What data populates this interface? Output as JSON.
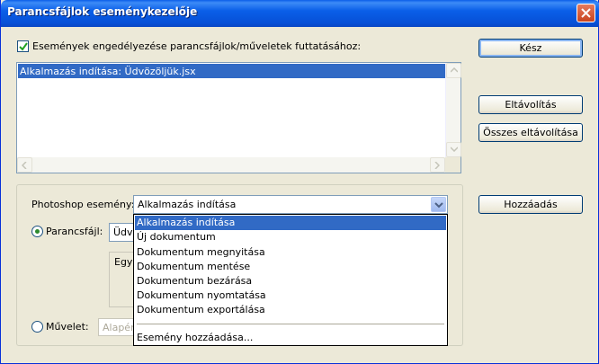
{
  "window": {
    "title": "Parancsfájlok eseménykezelője"
  },
  "enable_checkbox": {
    "checked": true,
    "label": "Események engedélyezése parancsfájlok/műveletek futtatásához:"
  },
  "events_list": {
    "items": [
      "Alkalmazás indítása: Üdvözöljük.jsx"
    ],
    "selected_index": 0
  },
  "group": {
    "event_label": "Photoshop esemény:",
    "event_value": "Alkalmazás indítása",
    "dropdown": {
      "options": [
        "Alkalmazás indítása",
        "Új dokumentum",
        "Dokumentum megnyitása",
        "Dokumentum mentése",
        "Dokumentum bezárása",
        "Dokumentum nyomtatása",
        "Dokumentum exportálása"
      ],
      "extra_option": "Esemény hozzáadása...",
      "selected_index": 0
    },
    "script_radio": {
      "label": "Parancsfájl:",
      "selected": true,
      "value": "Üdv"
    },
    "description_text": "Egys",
    "action_radio": {
      "label": "Művelet:",
      "selected": false,
      "value": "Alapért"
    }
  },
  "buttons": {
    "done": "Kész",
    "remove": "Eltávolítás",
    "remove_all": "Összes eltávolítása",
    "add": "Hozzáadás"
  },
  "colors": {
    "selection": "#316ac5",
    "title_bar": "#0a5fe8",
    "dialog_bg": "#ece9d8"
  }
}
